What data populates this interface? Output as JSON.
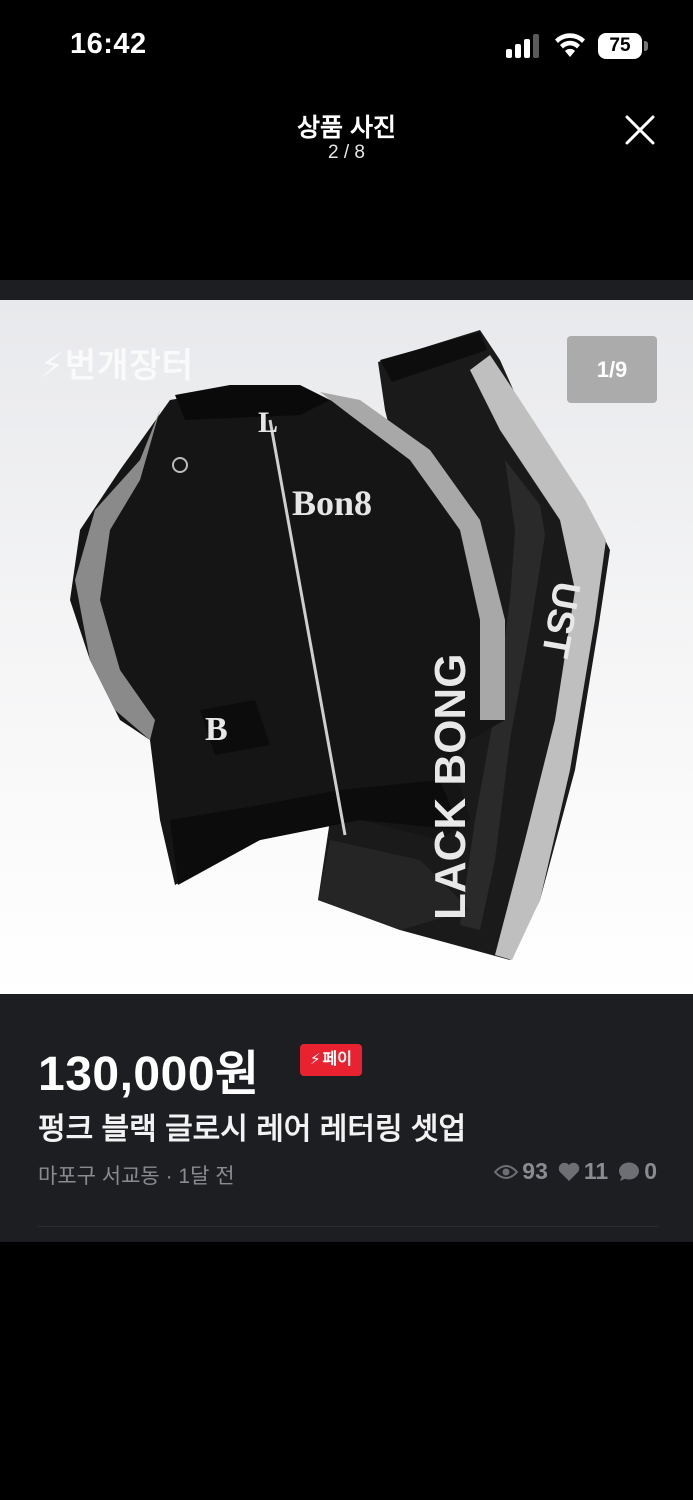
{
  "status_bar": {
    "time": "16:42",
    "battery": "75",
    "icons": [
      "signal-icon",
      "wifi-icon",
      "battery-icon"
    ]
  },
  "header": {
    "title": "상품 사진",
    "counter": "2 / 8",
    "close_icon": "close-icon"
  },
  "photo": {
    "watermark": "번개장터",
    "index": "1/9"
  },
  "product": {
    "price": "130,000원",
    "pay_badge": "페이",
    "title": "펑크 블랙 글로시 레어 레터링 셋업",
    "meta": "마포구 서교동 · 1달 전",
    "views": "93",
    "likes": "11",
    "chats": "0"
  },
  "colors": {
    "background": "#000000",
    "panel": "#1d1e22",
    "pay_badge": "#e8232f",
    "meta_text": "#8a8b90"
  }
}
